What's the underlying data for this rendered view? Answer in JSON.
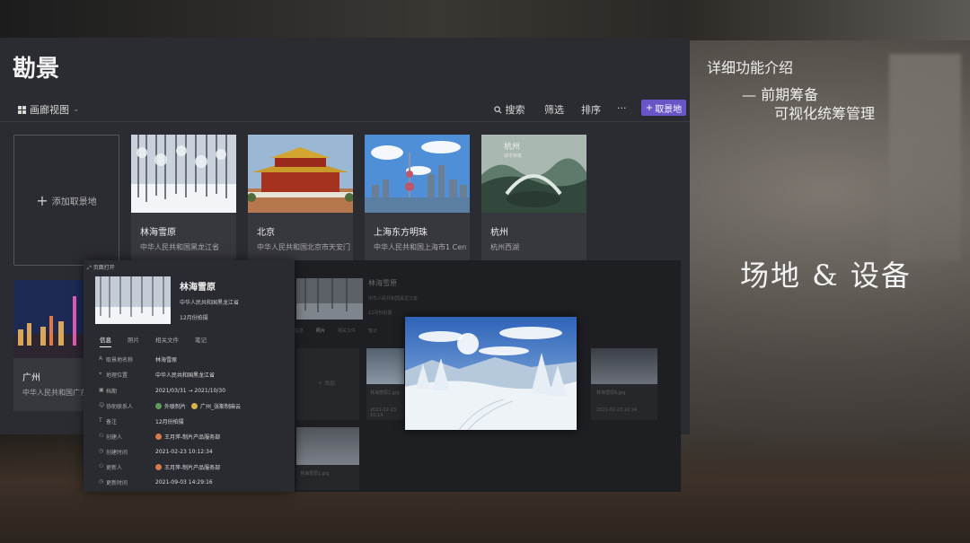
{
  "app": {
    "title": "勘景",
    "view_label": "画廊视图",
    "search_label": "搜索",
    "filter_label": "筛选",
    "sort_label": "排序",
    "more_label": "···",
    "add_button_label": "取景地",
    "add_card_label": "添加取景地",
    "cards": [
      {
        "name": "林海雪原",
        "address": "中华人民共和国黑龙江省"
      },
      {
        "name": "北京",
        "address": "中华人民共和国北京市天安门..."
      },
      {
        "name": "上海东方明珠",
        "address": "中华人民共和国上海市1 Cent..."
      },
      {
        "name": "杭州",
        "address": "杭州西湖",
        "thumb_title": "杭州",
        "thumb_sub": "城市映像"
      },
      {
        "name": "广州",
        "address": "中华人民共和国广东省"
      }
    ]
  },
  "detail": {
    "header": "页面打开",
    "name": "林海雪原",
    "address": "中华人民共和国黑龙江省",
    "time": "12月份拍摄",
    "tabs": [
      "信息",
      "照片",
      "相关文件",
      "笔记"
    ],
    "rows": [
      {
        "key": "取景地名称",
        "value": "林海雪原"
      },
      {
        "key": "地理位置",
        "value": "中华人民共和国黑龙江省"
      },
      {
        "key": "档期",
        "value": "2021/03/31 → 2021/10/30"
      },
      {
        "key": "协助联系人",
        "value": "外联制片",
        "value2": "广州_张斯制麻云"
      },
      {
        "key": "备注",
        "value": "12月份拍摄"
      },
      {
        "key": "创建人",
        "value": "王月萍-制片产品服务部"
      },
      {
        "key": "创建时间",
        "value": "2021-02-23 10:12:34"
      },
      {
        "key": "更新人",
        "value": "王月萍-制片产品服务部"
      },
      {
        "key": "更新时间",
        "value": "2021-09-03 14:29:16"
      }
    ]
  },
  "gallery": {
    "header": "页面打开",
    "name": "林海雪原",
    "address": "中华人民共和国黑龙江省",
    "time": "12月份拍摄",
    "tabs": [
      "信息",
      "照片",
      "相关文件",
      "笔记"
    ],
    "add_label": "添加",
    "captions": [
      "林海雪原1.jpg",
      "林海雪原8.jpg",
      "林海雪原1.jpg"
    ],
    "dates": [
      "2021-02-23 10:14",
      "2021-02-23 10:14"
    ]
  },
  "right_text": {
    "line1": "详细功能介绍",
    "line2": "— 前期筹备",
    "line3": "可视化统筹管理",
    "big": "场地 & 设备"
  }
}
